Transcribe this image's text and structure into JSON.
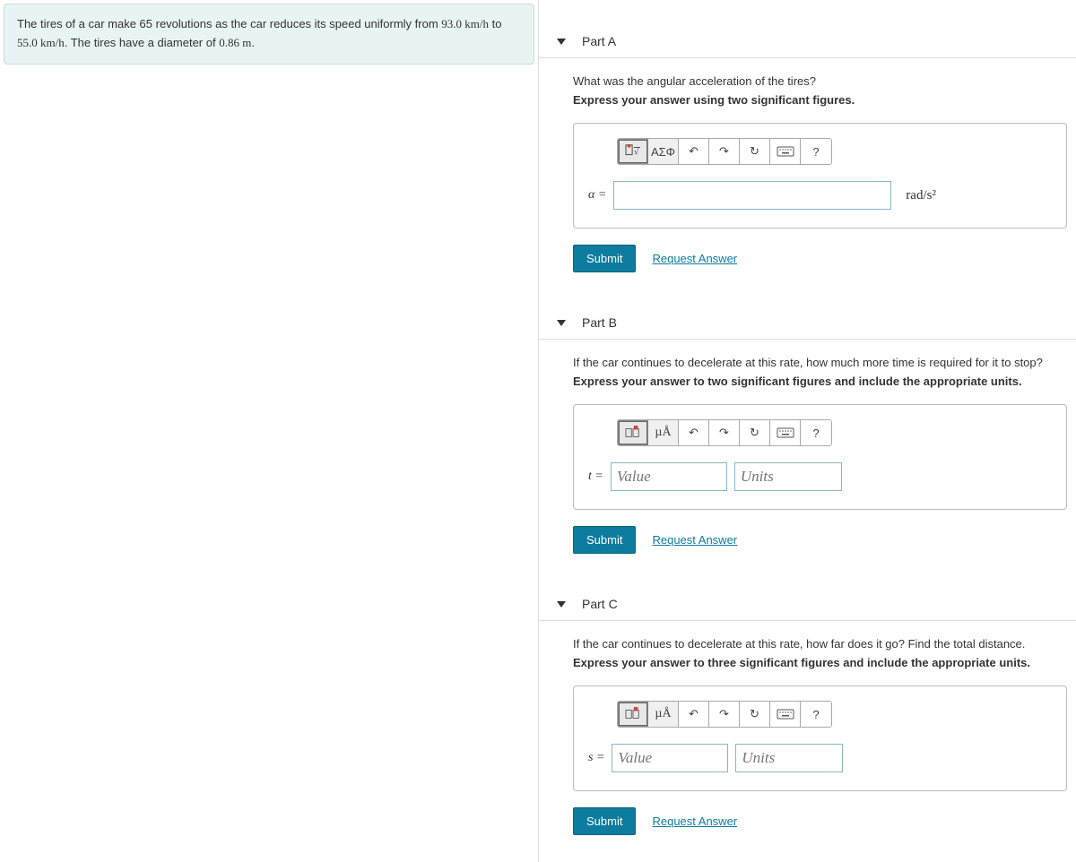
{
  "problem": {
    "text1": "The tires of a car make 65 revolutions as the car reduces its speed uniformly from ",
    "v1": "93.0 km/h",
    "text2": " to ",
    "v2": "55.0 km/h",
    "text3": ". The tires have a diameter of ",
    "diam": "0.86 m",
    "text4": "."
  },
  "toolbar": {
    "templates": "▯√",
    "greek": "ΑΣΦ",
    "units": "µÅ",
    "undo": "↶",
    "redo": "↷",
    "reset": "↻",
    "keyboard": "⌨",
    "help": "?"
  },
  "common": {
    "submit": "Submit",
    "request": "Request Answer"
  },
  "partA": {
    "title": "Part A",
    "question": "What was the angular acceleration of the tires?",
    "instruction": "Express your answer using two significant figures.",
    "var": "α =",
    "unit": "rad/s²"
  },
  "partB": {
    "title": "Part B",
    "question": "If the car continues to decelerate at this rate, how much more time is required for it to stop?",
    "instruction": "Express your answer to two significant figures and include the appropriate units.",
    "var": "t =",
    "value_ph": "Value",
    "units_ph": "Units"
  },
  "partC": {
    "title": "Part C",
    "question": "If the car continues to decelerate at this rate, how far does it go? Find the total distance.",
    "instruction": "Express your answer to three significant figures and include the appropriate units.",
    "var": "s =",
    "value_ph": "Value",
    "units_ph": "Units"
  }
}
